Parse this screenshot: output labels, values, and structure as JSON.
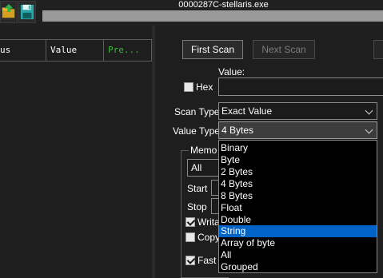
{
  "window": {
    "title": "0000287C-stellaris.exe"
  },
  "toolbar": {
    "open_icon": "open-process-icon",
    "save_icon": "save-icon"
  },
  "address_list": {
    "columns": [
      "us",
      "Value",
      "Pre..."
    ]
  },
  "scan": {
    "first_scan_label": "First Scan",
    "next_scan_label": "Next Scan",
    "value_label": "Value:",
    "hex_label": "Hex",
    "hex_checked": false,
    "scan_type_label": "Scan Type",
    "scan_type_value": "Exact Value",
    "value_type_label": "Value Type",
    "value_type_value": "4 Bytes"
  },
  "memory": {
    "group_label": "Memo",
    "region_value": "All",
    "start_label": "Start",
    "stop_label": "Stop",
    "writable_label": "Writa",
    "writable_checked": true,
    "copy_label": "Copy",
    "copy_checked": false,
    "fast_label": "Fast S",
    "fast_checked": true
  },
  "value_type_dropdown": {
    "options": [
      "Binary",
      "Byte",
      "2 Bytes",
      "4 Bytes",
      "8 Bytes",
      "Float",
      "Double",
      "String",
      "Array of byte",
      "All",
      "Grouped"
    ],
    "highlighted": "String"
  },
  "colors": {
    "background": "#1e1e1e",
    "accent_selection": "#0063c7",
    "previous_column": "#3ab83a"
  }
}
